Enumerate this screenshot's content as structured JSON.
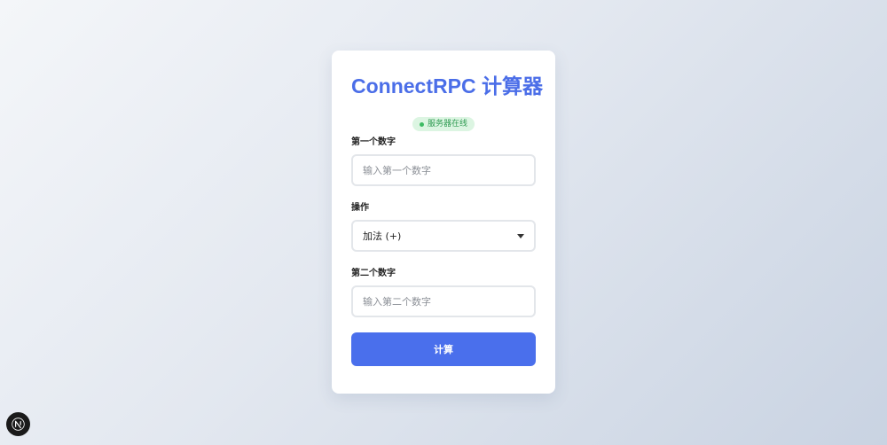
{
  "calculator": {
    "title": "ConnectRPC 计算器",
    "status": "服务器在线",
    "first_number": {
      "label": "第一个数字",
      "placeholder": "输入第一个数字",
      "value": ""
    },
    "operation": {
      "label": "操作",
      "selected": "加法 (+)"
    },
    "second_number": {
      "label": "第二个数字",
      "placeholder": "输入第二个数字",
      "value": ""
    },
    "submit_label": "计算"
  },
  "devtools": {
    "icon": "nextjs-logo-icon"
  },
  "colors": {
    "accent": "#4a6fec",
    "title": "#4b6ee8",
    "status_bg": "#dcf5e2",
    "status_text": "#2f9b52",
    "status_dot": "#3dbb63"
  }
}
